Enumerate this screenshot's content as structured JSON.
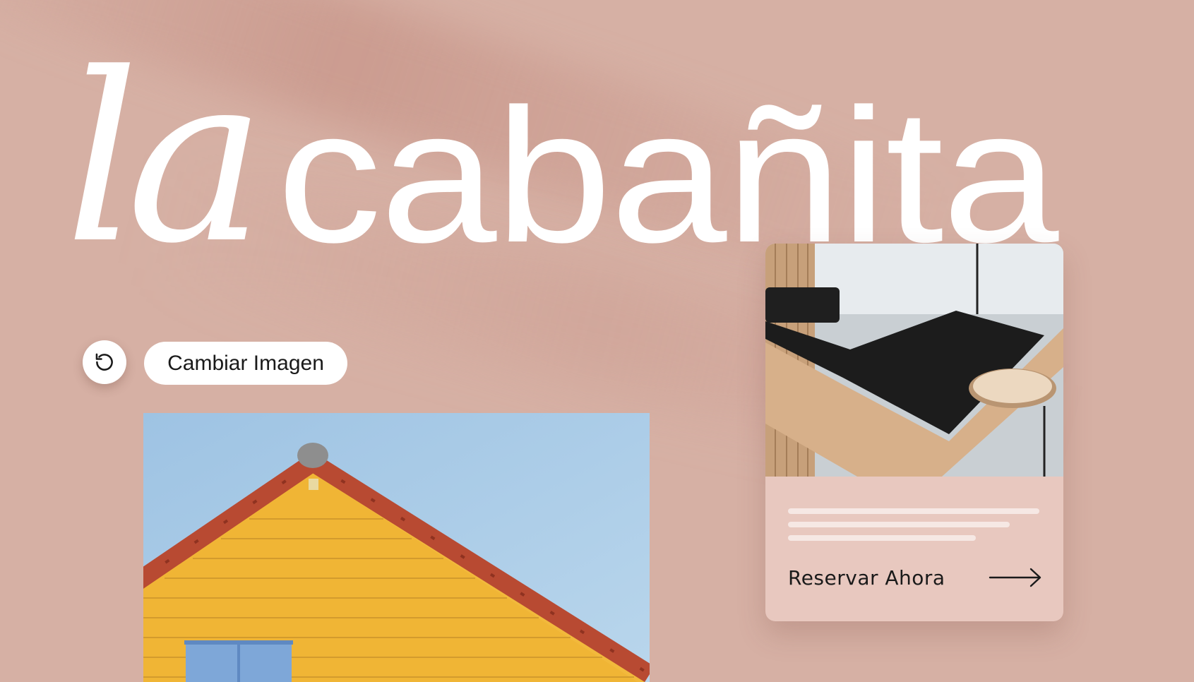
{
  "brand": {
    "prefix": "la",
    "name": "cabañita"
  },
  "controls": {
    "refresh_icon": "rotate-ccw-icon",
    "change_image_label": "Cambiar Imagen"
  },
  "card": {
    "cta_label": "Reservar Ahora",
    "cta_icon": "arrow-right-icon",
    "placeholder_lines": [
      1.0,
      0.88,
      0.75
    ]
  },
  "colors": {
    "background": "#d6b0a4",
    "card": "#e8c8bf",
    "text_light": "#ffffff",
    "text_dark": "#1a1a1a"
  }
}
